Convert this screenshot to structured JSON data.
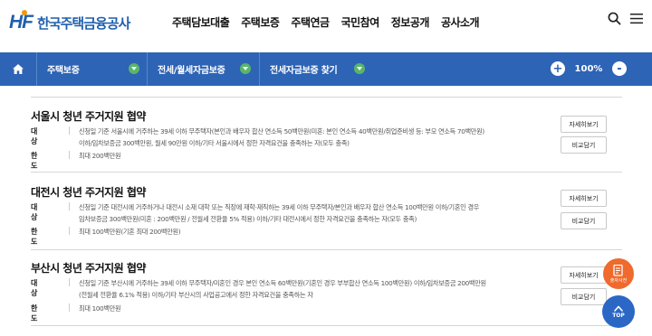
{
  "logo": {
    "mark": "HF",
    "name": "한국주택금융공사"
  },
  "gnb": [
    "주택담보대출",
    "주택보증",
    "주택연금",
    "국민참여",
    "정보공개",
    "공사소개"
  ],
  "nav": {
    "crumb1": "주택보증",
    "crumb2": "전세/월세자금보증",
    "crumb3": "전세자금보증 찾기",
    "zoom_in": "+",
    "zoom_level": "100%",
    "zoom_out": "-"
  },
  "items": [
    {
      "title": "서울시 청년 주거지원 협약",
      "label_target": "대상",
      "target_line1": "신청일 기준 서울시에 거주하는 39세 이하 무주택자(본인과 배우자 합산 연소득 50백만원(미혼: 본인 연소득 40백만원/취업준비생 등: 부모 연소득 70백만원)",
      "target_line2": "이하/임차보증금 300백만원, 월세 90만원 이하/기타 서울시에서 정한 자격요건을 충족하는 자(모두 충족)",
      "label_limit": "한도",
      "limit": "최대 200백만원",
      "detail_btn": "자세히보기",
      "compare_btn": "비교담기"
    },
    {
      "title": "대전시 청년 주거지원 협약",
      "label_target": "대상",
      "target_line1": "신청일 기준 대전시에 거주하거나 대전시 소재 대학 또는 직장에 재학·재직하는 39세 이하 무주택자/본인과 배우자 합산 연소득 100백만원 이하/기혼인 경우",
      "target_line2": "임차보증금 300백만원(미혼 : 200백만원 / 전월세 전환율 5% 적용) 이하/기타 대전시에서 정한 자격요건을 충족하는 자(모두 충족)",
      "label_limit": "한도",
      "limit": "최대 100백만원(기혼 최대 200백만원)",
      "detail_btn": "자세히보기",
      "compare_btn": "비교담기"
    },
    {
      "title": "부산시 청년 주거지원 협약",
      "label_target": "대상",
      "target_line1": "신청일 기준 부산시에 거주하는 39세 이하 무주택자/미혼인 경우 본인 연소득 60백만원(기혼인 경우 부부합산 연소득 100백만원) 이하/임차보증금 200백만원",
      "target_line2": "(전월세 전환율 6.1% 적용) 이하/기타 부산시의 사업공고에서 정한 자격요건을 충족하는 자",
      "label_limit": "한도",
      "limit": "최대 100백만원",
      "detail_btn": "자세히보기",
      "compare_btn": "비교담기"
    }
  ],
  "fab": {
    "apply_label": "출자사전",
    "top_label": "TOP"
  },
  "colors": {
    "brand": "#1f5fae",
    "navbar": "#2d64b5",
    "green_dot": "#5ab56a",
    "orange_fab": "#ef6a2c",
    "top_fab": "#2b67c5"
  }
}
